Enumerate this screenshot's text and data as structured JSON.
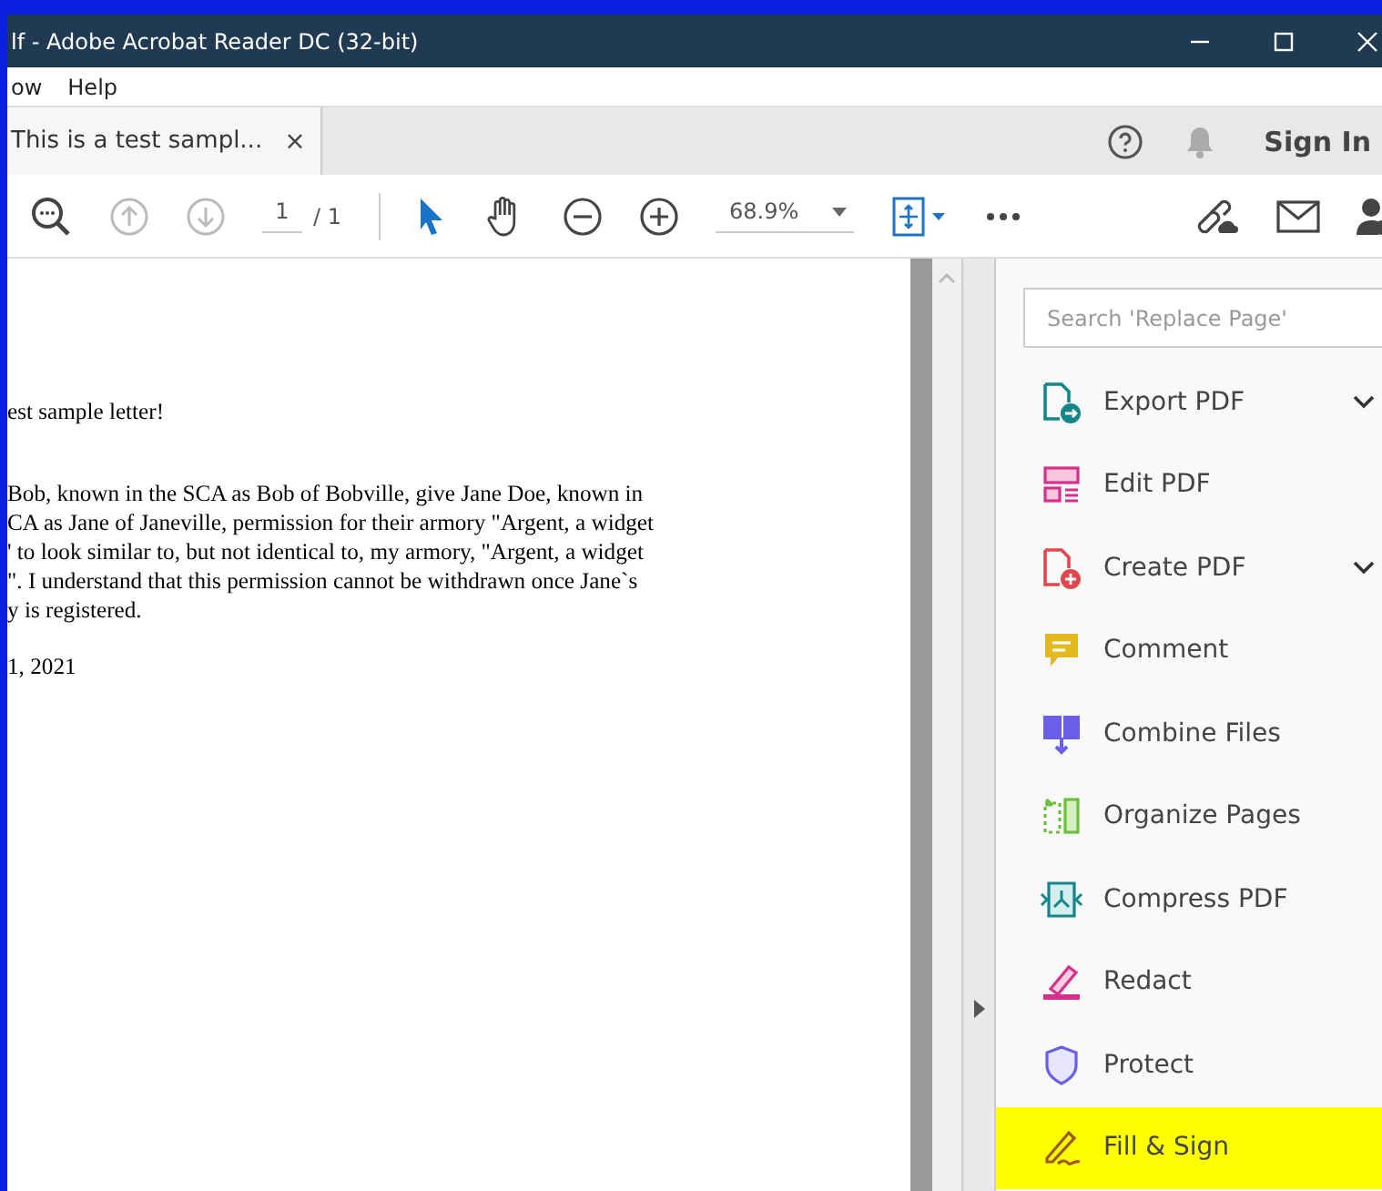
{
  "window": {
    "title": "lf - Adobe Acrobat Reader DC (32-bit)"
  },
  "menu": [
    "ow",
    "Help"
  ],
  "tabs": [
    {
      "label": "This is a test sampl...",
      "close": "×",
      "selected": true
    }
  ],
  "header": {
    "sign_in": "Sign In"
  },
  "toolbar": {
    "page": "1",
    "page_total": "/ 1",
    "zoom": "68.9%"
  },
  "document": {
    "heading": "est sample letter!",
    "paragraph": [
      "Bob, known in the SCA as Bob of Bobville, give Jane Doe, known in",
      "CA as Jane of Janeville, permission for their armory \"Argent, a widget",
      "' to look similar to, but not identical to, my armory, \"Argent, a widget",
      "\". I understand that this permission cannot be withdrawn once Jane`s",
      "y is registered."
    ],
    "date": "1, 2021"
  },
  "tools_panel": {
    "search": {
      "placeholder": "Search 'Replace Page'"
    },
    "tools": [
      {
        "label": "Export PDF",
        "kind": "export",
        "chevron": true,
        "selected": false
      },
      {
        "label": "Edit PDF",
        "kind": "edit",
        "chevron": false,
        "selected": false
      },
      {
        "label": "Create PDF",
        "kind": "create",
        "chevron": true,
        "selected": false
      },
      {
        "label": "Comment",
        "kind": "comment",
        "chevron": false,
        "selected": false
      },
      {
        "label": "Combine Files",
        "kind": "combine",
        "chevron": false,
        "selected": false
      },
      {
        "label": "Organize Pages",
        "kind": "organize",
        "chevron": false,
        "selected": false
      },
      {
        "label": "Compress PDF",
        "kind": "compress",
        "chevron": false,
        "selected": false
      },
      {
        "label": "Redact",
        "kind": "redact",
        "chevron": false,
        "selected": false
      },
      {
        "label": "Protect",
        "kind": "protect",
        "chevron": false,
        "selected": false
      },
      {
        "label": "Fill & Sign",
        "kind": "sign",
        "chevron": false,
        "selected": true
      }
    ]
  }
}
